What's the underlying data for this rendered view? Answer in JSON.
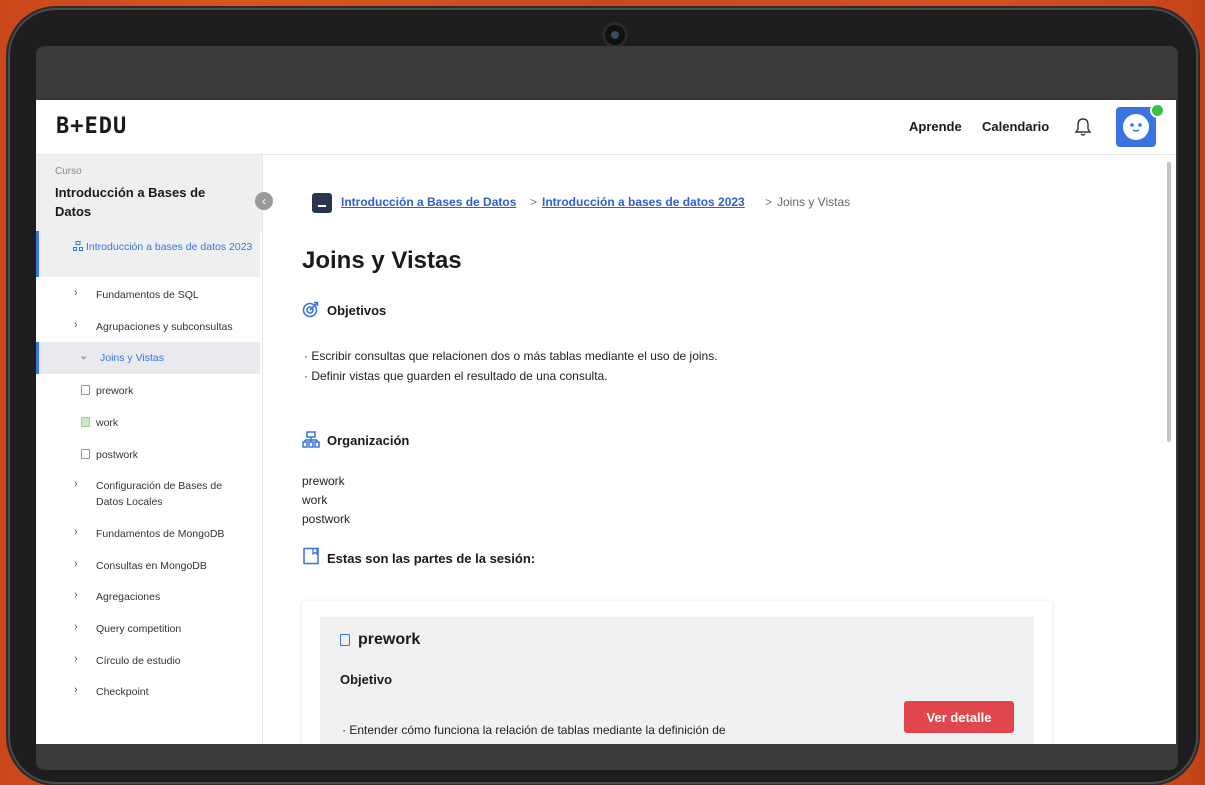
{
  "header": {
    "logo": "B+EDU",
    "nav": [
      "Aprende",
      "Calendario"
    ]
  },
  "sidebar": {
    "course_label": "Curso",
    "course_title": "Introducción a Bases de Datos",
    "module": "Introducción a bases de datos 2023",
    "items": [
      {
        "label": "Fundamentos de SQL"
      },
      {
        "label": "Agrupaciones y subconsultas"
      },
      {
        "label": "Joins y Vistas"
      },
      {
        "label": "prework"
      },
      {
        "label": "work"
      },
      {
        "label": "postwork"
      },
      {
        "label": "Configuración de Bases de Datos Locales"
      },
      {
        "label": "Fundamentos de MongoDB"
      },
      {
        "label": "Consultas en MongoDB"
      },
      {
        "label": "Agregaciones"
      },
      {
        "label": "Query competition"
      },
      {
        "label": "Círculo de estudio"
      },
      {
        "label": "Checkpoint"
      }
    ]
  },
  "breadcrumb": {
    "items": [
      "Introducción a Bases de Datos",
      "Introducción a bases de datos 2023",
      "Joins y Vistas"
    ],
    "separator": ">"
  },
  "main": {
    "title": "Joins y Vistas",
    "objectives_heading": "Objetivos",
    "objectives": [
      "Escribir consultas que relacionen dos o más tablas mediante el uso de joins.",
      "Definir vistas que guarden el resultado de una consulta."
    ],
    "organization_heading": "Organización",
    "organization": [
      "prework",
      "work",
      "postwork"
    ],
    "parts_heading": "Estas son las partes de la sesión:",
    "card": {
      "title": "prework",
      "subtitle": "Objetivo",
      "bullet": "Entender cómo funciona la relación de tablas mediante la definición de",
      "button": "Ver detalle"
    }
  },
  "colors": {
    "accent": "#3a74e0",
    "button": "#e0474c",
    "online": "#3cc24a"
  }
}
